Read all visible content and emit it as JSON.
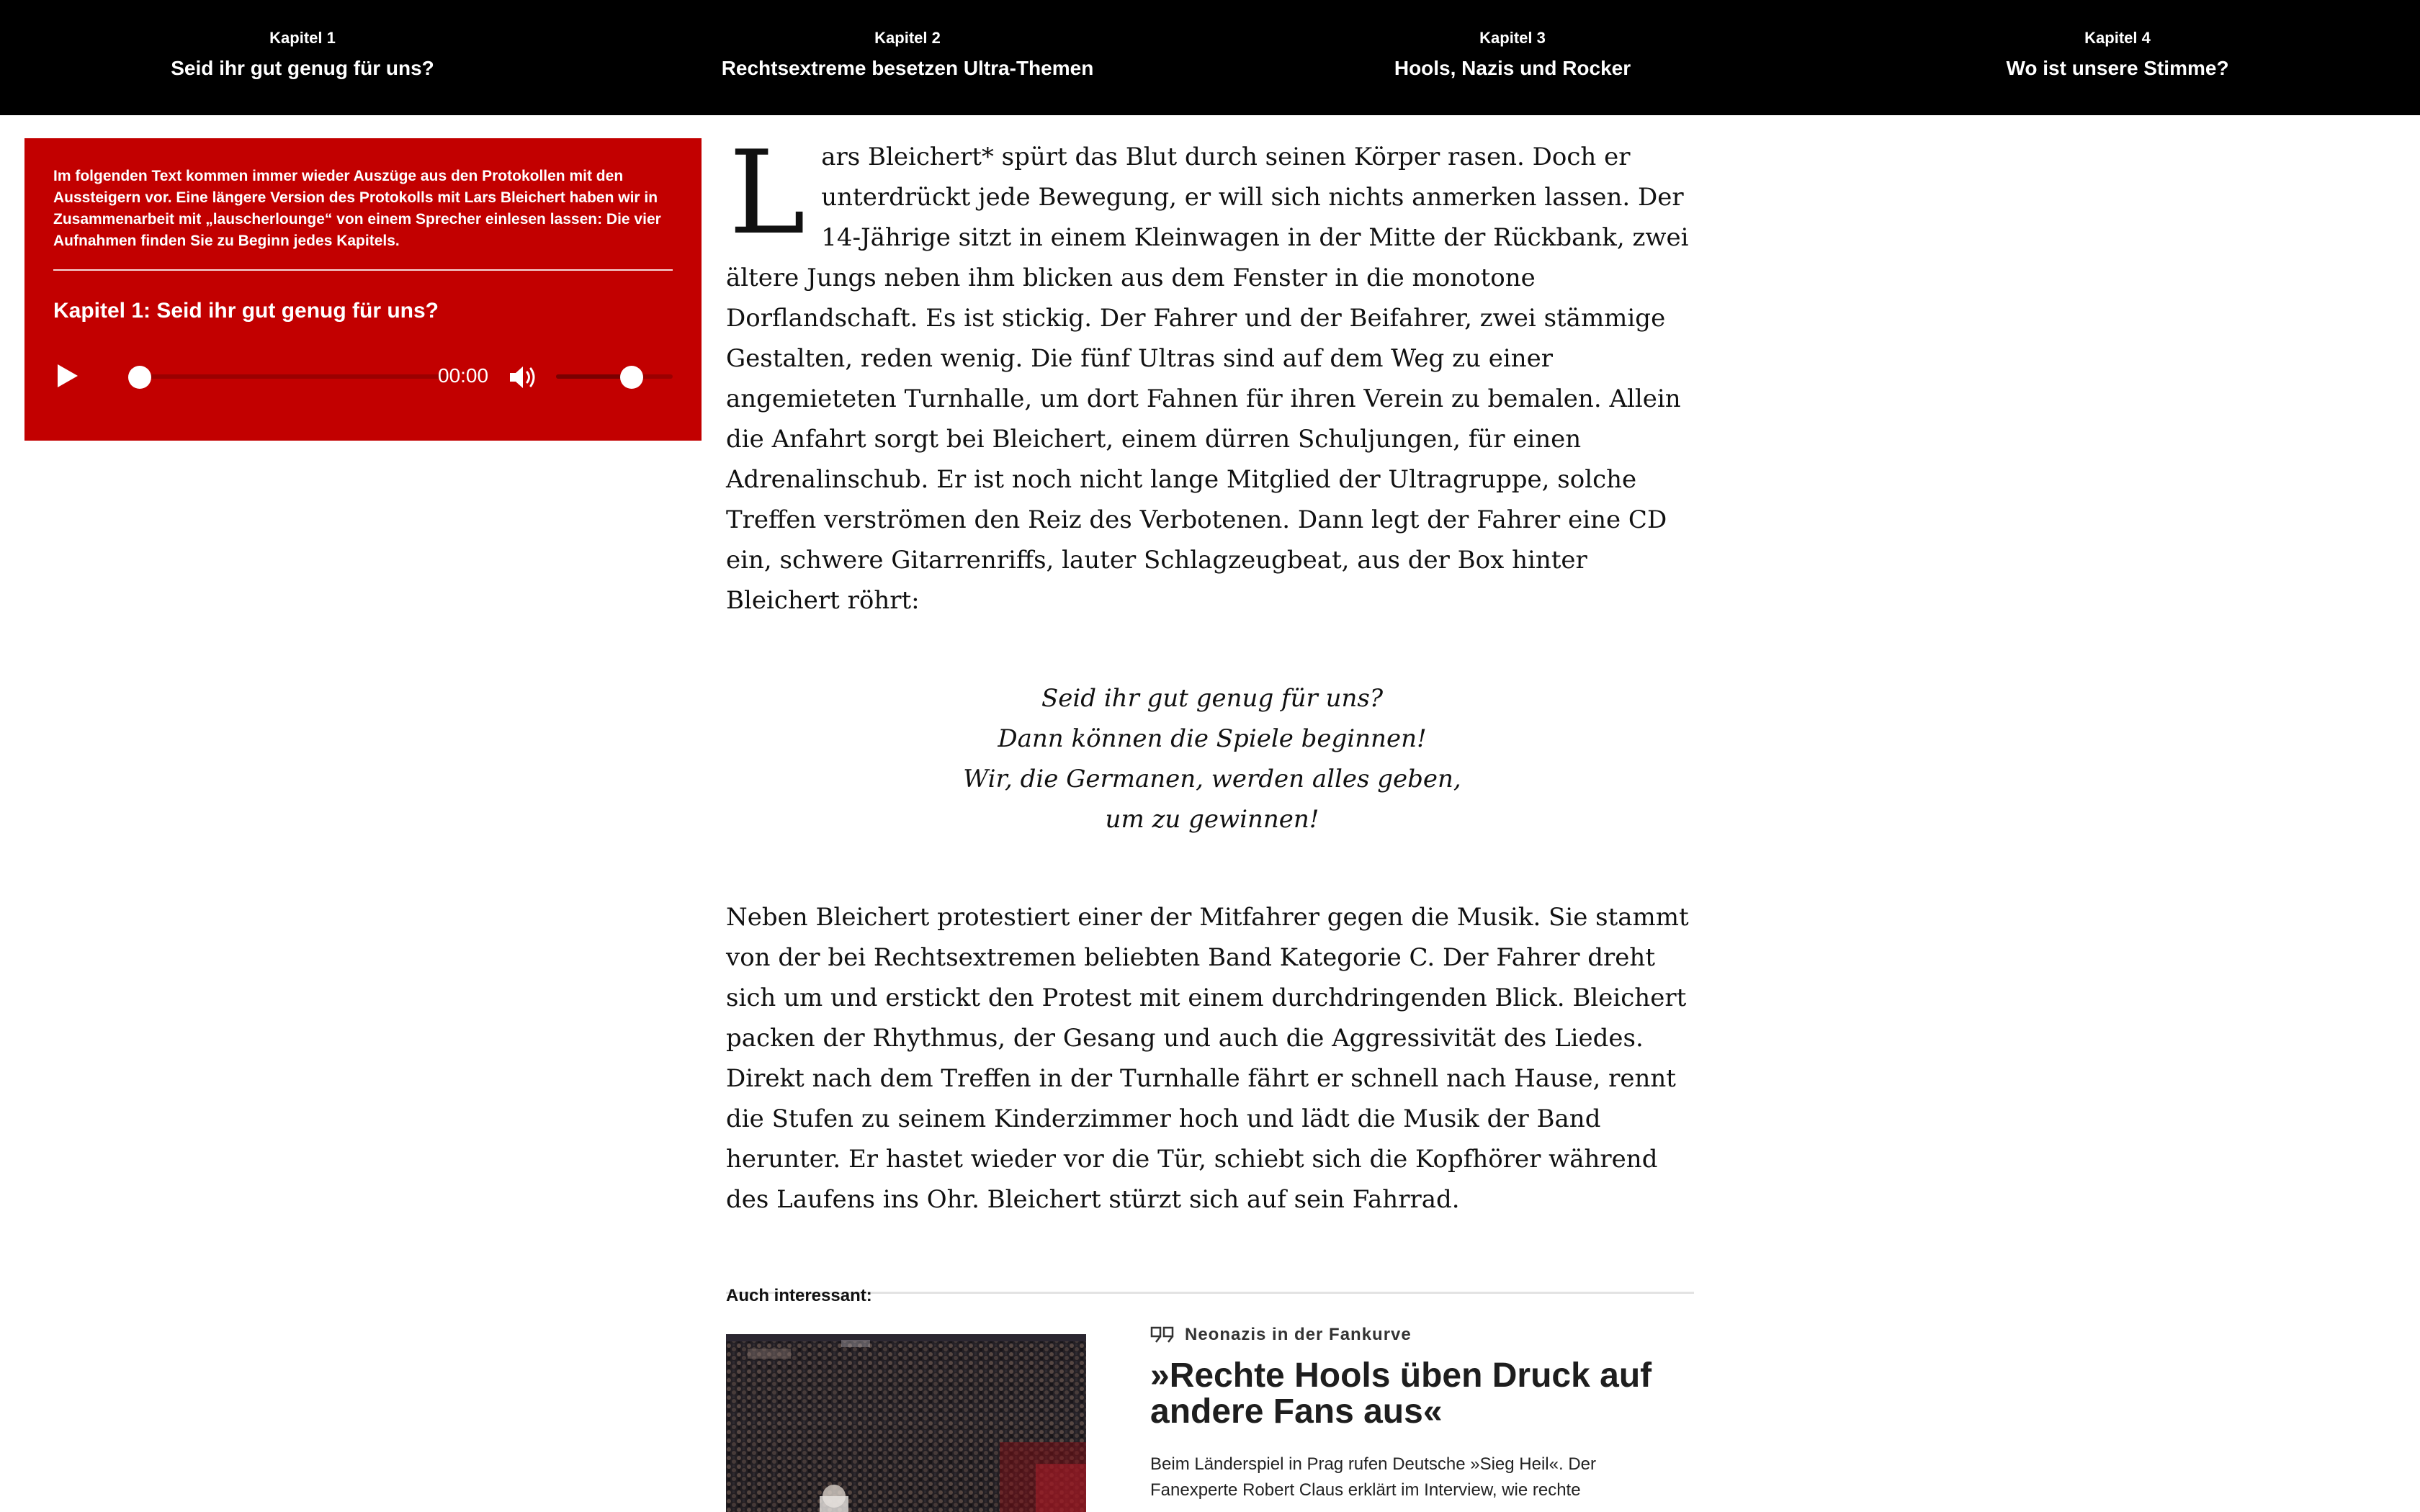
{
  "nav": {
    "chapters": [
      {
        "kicker": "Kapitel 1",
        "title": "Seid ihr gut genug für uns?"
      },
      {
        "kicker": "Kapitel 2",
        "title": "Rechtsextreme besetzen Ultra-Themen"
      },
      {
        "kicker": "Kapitel 3",
        "title": "Hools, Nazis und Rocker"
      },
      {
        "kicker": "Kapitel 4",
        "title": "Wo ist unsere Stimme?"
      }
    ]
  },
  "audio": {
    "intro": "Im folgenden Text kommen immer wieder Auszüge aus den Protokollen mit den Aussteigern vor. Eine längere Version des Protokolls mit Lars Bleichert haben wir in Zusammenarbeit mit „lauscherlounge“ von einem Sprecher einlesen lassen: Die vier Aufnahmen finden Sie zu Beginn jedes Kapitels.",
    "chapter_title": "Kapitel 1: Seid ihr gut genug für uns?",
    "time": "00:00",
    "progress_fraction": 0.0,
    "volume_fraction": 0.65,
    "icons": {
      "play": "play-icon",
      "volume": "speaker-icon"
    },
    "colors": {
      "background": "#c20000",
      "track": "#9a0000",
      "knob": "#ffffff"
    }
  },
  "article": {
    "dropcap": "L",
    "para1": "ars Bleichert* spürt das Blut durch seinen Körper rasen. Doch er unterdrückt jede Bewegung, er will sich nichts anmerken lassen. Der 14-Jährige sitzt in einem Kleinwagen in der Mitte der Rückbank, zwei ältere Jungs neben ihm blicken aus dem Fenster in die monotone Dorflandschaft. Es ist stickig. Der Fahrer und der Beifahrer, zwei stämmige Gestalten, reden wenig. Die fünf Ultras sind auf dem Weg zu einer angemieteten Turnhalle, um dort Fahnen für ihren Verein zu bemalen. Allein die Anfahrt sorgt bei Bleichert, einem dürren Schuljungen, für einen Adrenalinschub. Er ist noch nicht lange Mitglied der Ultragruppe, solche Treffen verströmen den Reiz des Verbotenen. Dann legt der Fahrer eine CD ein, schwere Gitarrenriffs, lauter Schlagzeugbeat, aus der Box hinter Bleichert röhrt:",
    "lyrics": [
      "Seid ihr gut genug für uns?",
      "Dann können die Spiele beginnen!",
      "Wir, die Germanen, werden alles geben,",
      "um zu gewinnen!"
    ],
    "para2": "Neben Bleichert protestiert einer der Mitfahrer gegen die Musik. Sie stammt von der bei Rechtsextremen beliebten Band Kategorie C. Der Fahrer dreht sich um und erstickt den Protest mit einem durchdringenden Blick. Bleichert packen der Rhythmus, der Gesang und auch die Aggressivität des Liedes. Direkt nach dem Treffen in der Turnhalle fährt er schnell nach Hause, rennt die Stufen zu seinem Kinderzimmer hoch und lädt die Musik der Band herunter. Er hastet wieder vor die Tür, schiebt sich die Kopfhörer während des Laufens ins Ohr. Bleichert stürzt sich auf sein Fahrrad."
  },
  "related": {
    "label": "Auch interessant:",
    "kicker": "Neonazis in der Fankurve",
    "kicker_icon": "quote-icon",
    "headline": "»Rechte Hools üben Druck auf andere Fans aus«",
    "lead": "Beim Länderspiel in Prag rufen Deutsche »Sieg Heil«. Der Fanexperte Robert Claus erklärt im Interview, wie rechte"
  }
}
